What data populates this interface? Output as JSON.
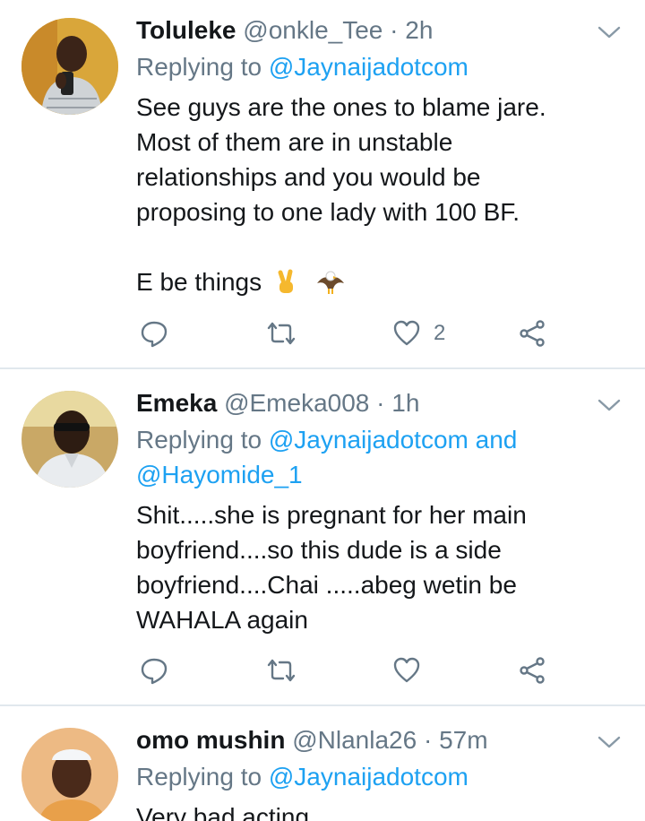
{
  "tweets": [
    {
      "name": "Toluleke",
      "handle": "@onkle_Tee",
      "time": "2h",
      "replying_prefix": "Replying to",
      "mentions": [
        "@Jaynaijadotcom"
      ],
      "text_lines": [
        "See guys are the ones to blame jare.",
        "Most of them are in unstable",
        "relationships and you would be",
        "proposing to one lady with 100 BF.",
        "",
        "E be things"
      ],
      "emojis": [
        "victory-hand",
        "eagle"
      ],
      "like_count": "2",
      "colors": {
        "avatar_bg": "#f0c24a"
      }
    },
    {
      "name": "Emeka",
      "handle": "@Emeka008",
      "time": "1h",
      "replying_prefix": "Replying to",
      "mentions": [
        "@Jaynaijadotcom",
        "@Hayomide_1"
      ],
      "mention_joiner": "and",
      "text_lines": [
        "Shit.....she is pregnant for her main",
        "boyfriend....so this dude is a side",
        "boyfriend....Chai .....abeg wetin be",
        "WAHALA again"
      ],
      "like_count": "",
      "colors": {
        "avatar_bg": "#d9c07a"
      }
    },
    {
      "name": "omo mushin",
      "handle": "@Nlanla26",
      "time": "57m",
      "replying_prefix": "Replying to",
      "mentions": [
        "@Jaynaijadotcom"
      ],
      "text_lines": [
        "Very bad acting"
      ],
      "colors": {
        "avatar_bg": "#e8a07a"
      }
    }
  ],
  "separator": "·",
  "icons": [
    "reply-icon",
    "retweet-icon",
    "like-icon",
    "share-icon",
    "chevron-down-icon"
  ],
  "colors": {
    "link": "#1da1f2",
    "secondary": "#657786",
    "divider": "#e1e8ed"
  }
}
